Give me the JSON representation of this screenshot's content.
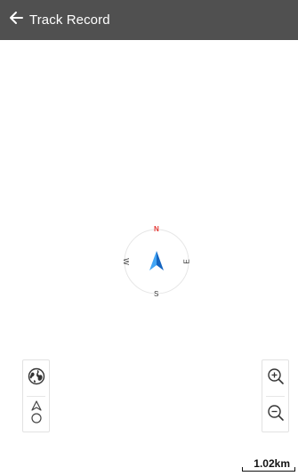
{
  "header": {
    "title": "Track Record",
    "back_icon": "arrow-left-icon"
  },
  "compass": {
    "north": "N",
    "south": "S",
    "east": "E",
    "west": "W",
    "north_color": "#e53935",
    "arrow_color": "#1e88e5"
  },
  "map_controls": {
    "left": [
      {
        "icon": "globe-icon"
      },
      {
        "icon": "location-pin-icon"
      }
    ],
    "right": [
      {
        "icon": "zoom-in-icon"
      },
      {
        "icon": "zoom-out-icon"
      }
    ]
  },
  "scale": {
    "label": "1.02km"
  },
  "colors": {
    "app_bar": "#505050",
    "background": "#ffffff"
  }
}
